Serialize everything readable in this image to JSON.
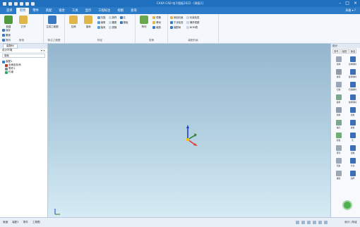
{
  "window": {
    "title": "CAXA CAD 电子图板2022 - [装配1]",
    "controls": [
      "–",
      "□",
      "×"
    ]
  },
  "menu": {
    "tabs": [
      "菜单",
      "常用",
      "零件",
      "装配",
      "钣金",
      "工具",
      "显示",
      "工程标注",
      "视图",
      "查询"
    ],
    "active": "常用",
    "right_text": "风格 ▾ ?"
  },
  "ribbon": {
    "groups": [
      {
        "label": "常用",
        "big": [
          "新建",
          "打开"
        ],
        "small": [
          [
            "保存",
            "另存"
          ],
          [
            "撤销",
            "恢复"
          ],
          [
            "剪切",
            "粘贴"
          ]
        ]
      },
      {
        "label": "标注工程图",
        "big": [
          "生成工程图"
        ],
        "small": []
      },
      {
        "label": "特征",
        "big": [
          "拉伸",
          "旋转"
        ],
        "small": [
          [
            "扫描",
            "放样"
          ],
          [
            "倒角",
            "圆角"
          ],
          [
            "抽壳",
            "拔模"
          ],
          [
            "孔",
            "筋板"
          ]
        ]
      },
      {
        "label": "变换",
        "big": [
          "阵列"
        ],
        "small": [
          [
            "镜像",
            "移动"
          ],
          [
            "缩放",
            "旋转"
          ]
        ]
      },
      {
        "label": "装配约束",
        "big": [],
        "small": [
          [
            "添加约束",
            "约束检查"
          ],
          [
            "干涉检查",
            "爆炸视图"
          ],
          [
            "装配树",
            "BOM表"
          ]
        ]
      }
    ]
  },
  "left_panel": {
    "tab": "装配树",
    "subtitle": "设计环境",
    "search_placeholder": "搜索",
    "tree": [
      {
        "label": "装配1",
        "children": [
          "全局坐标系",
          "零件1",
          "约束"
        ]
      }
    ]
  },
  "right_panel": {
    "title": "设计",
    "tabs": [
      "零件",
      "装配",
      "钣金"
    ],
    "items": [
      {
        "label": "拉伸",
        "color": "#9aa7b7"
      },
      {
        "label": "拉伸除料",
        "color": "#3b6fb6"
      },
      {
        "label": "旋转",
        "color": "#8f9bab"
      },
      {
        "label": "旋转除料",
        "color": "#3b6fb6"
      },
      {
        "label": "扫描",
        "color": "#9aa7b7"
      },
      {
        "label": "扫描除料",
        "color": "#3b6fb6"
      },
      {
        "label": "放样",
        "color": "#7ea68a"
      },
      {
        "label": "放样除料",
        "color": "#3b6fb6"
      },
      {
        "label": "倒角",
        "color": "#8f9bab"
      },
      {
        "label": "圆角",
        "color": "#3b6fb6"
      },
      {
        "label": "抽壳",
        "color": "#7ea68a"
      },
      {
        "label": "拔模",
        "color": "#3b6fb6"
      },
      {
        "label": "筋板",
        "color": "#6fae73"
      },
      {
        "label": "孔",
        "color": "#3b6fb6"
      },
      {
        "label": "阵列",
        "color": "#9aa7b7"
      },
      {
        "label": "镜像",
        "color": "#3b6fb6"
      },
      {
        "label": "包裹",
        "color": "#9aa7b7"
      },
      {
        "label": "分割",
        "color": "#3b6fb6"
      },
      {
        "label": "螺纹",
        "color": "#9aa7b7"
      },
      {
        "label": "加厚",
        "color": "#3b6fb6"
      }
    ]
  },
  "status": {
    "left": [
      "就绪",
      "装配1",
      "零件",
      "工程图"
    ],
    "right": "设计 | 特征"
  },
  "colors": {
    "titlebar": "#1f6fbf",
    "menubar": "#2b7bc9",
    "axis_x": "#e53935",
    "axis_y": "#2e7d32",
    "axis_z": "#1e3fd1"
  }
}
